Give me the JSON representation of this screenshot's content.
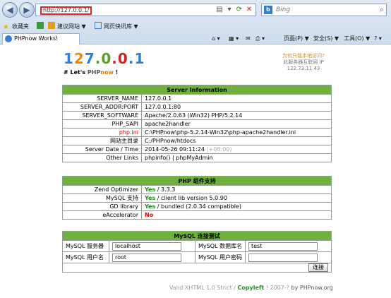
{
  "browser": {
    "address": "http://127.0.0.1/",
    "search_placeholder": "Bing",
    "favorites": [
      {
        "label": "收藏夹",
        "arrow": ""
      },
      {
        "label": "建议网站",
        "arrow": "▼"
      },
      {
        "label": "网页快讯库",
        "arrow": "▼"
      }
    ],
    "tab_title": "PHPnow Works!",
    "commands": [
      {
        "label": "页面(P)",
        "arrow": "▼"
      },
      {
        "label": "安全(S)",
        "arrow": "▼"
      },
      {
        "label": "工具(O)",
        "arrow": "▼"
      }
    ]
  },
  "page": {
    "logo_chars": [
      {
        "c": "1",
        "color": "#2f7fd8"
      },
      {
        "c": "2",
        "color": "#ef8a00"
      },
      {
        "c": "7",
        "color": "#2f7fd8"
      },
      {
        "c": ".",
        "color": "#5aa01e"
      },
      {
        "c": "0",
        "color": "#5aa01e"
      },
      {
        "c": ".",
        "color": "#d42020"
      },
      {
        "c": "0",
        "color": "#d42020"
      },
      {
        "c": ".",
        "color": "#2f7fd8"
      },
      {
        "c": "1",
        "color": "#2f7fd8"
      }
    ],
    "tagline": {
      "prefix": "# Let's ",
      "php": "PHP",
      "now": "now",
      "suffix": " !"
    },
    "ip_box": {
      "question": "为何只能本地访问?",
      "label": "此服务器互联网 IP",
      "ip": "122.73.11.43"
    },
    "server_info": {
      "title": "Server Information",
      "rows": [
        {
          "k": "SERVER_NAME",
          "v": "127.0.0.1"
        },
        {
          "k": "SERVER_ADDR:PORT",
          "v": "127.0.0.1:80"
        },
        {
          "k": "SERVER_SOFTWARE",
          "v": "Apache/2.0.63 (Win32) PHP/5.2.14"
        },
        {
          "k": "PHP_SAPI",
          "v": "apache2handler"
        },
        {
          "k": "php.ini",
          "v": "C:\\PHPnow\\php-5.2.14-Win32\\php-apache2handler.ini"
        },
        {
          "k": "网站主目录",
          "v": "C:/PHPnow/htdocs"
        }
      ],
      "date_label": "Server Date / Time",
      "date_value": "2014-05-26 09:11:24",
      "date_tz": "(+08:00)",
      "links_label": "Other Links",
      "link_phpinfo": "phpinfo()",
      "link_sep": " | ",
      "link_pma": "phpMyAdmin"
    },
    "components": {
      "title": "PHP 组件支持",
      "rows": [
        {
          "k": "Zend Optimizer",
          "status": "Yes",
          "detail": " / 3.3.3"
        },
        {
          "k": "MySQL 支持",
          "status": "Yes",
          "detail": " / client lib version 5.0.90"
        },
        {
          "k": "GD library",
          "status": "Yes",
          "detail": " / bundled (2.0.34 compatible)"
        },
        {
          "k": "eAccelerator",
          "status": "No",
          "detail": ""
        }
      ]
    },
    "mysql": {
      "title": "MySQL 连接测试",
      "server_label": "MySQL 服务器",
      "server_value": "localhost",
      "db_label": "MySQL 数据库名",
      "db_value": "test",
      "user_label": "MySQL 用户名",
      "user_value": "root",
      "pass_label": "MySQL 用户密码",
      "pass_value": "",
      "connect_label": "连接"
    },
    "footer": {
      "valid": "Valid XHTML 1.0 Strict / ",
      "copyleft": "Copyleft",
      "rest": " ! 2007-? ",
      "by": "by PHPnow.org"
    }
  }
}
